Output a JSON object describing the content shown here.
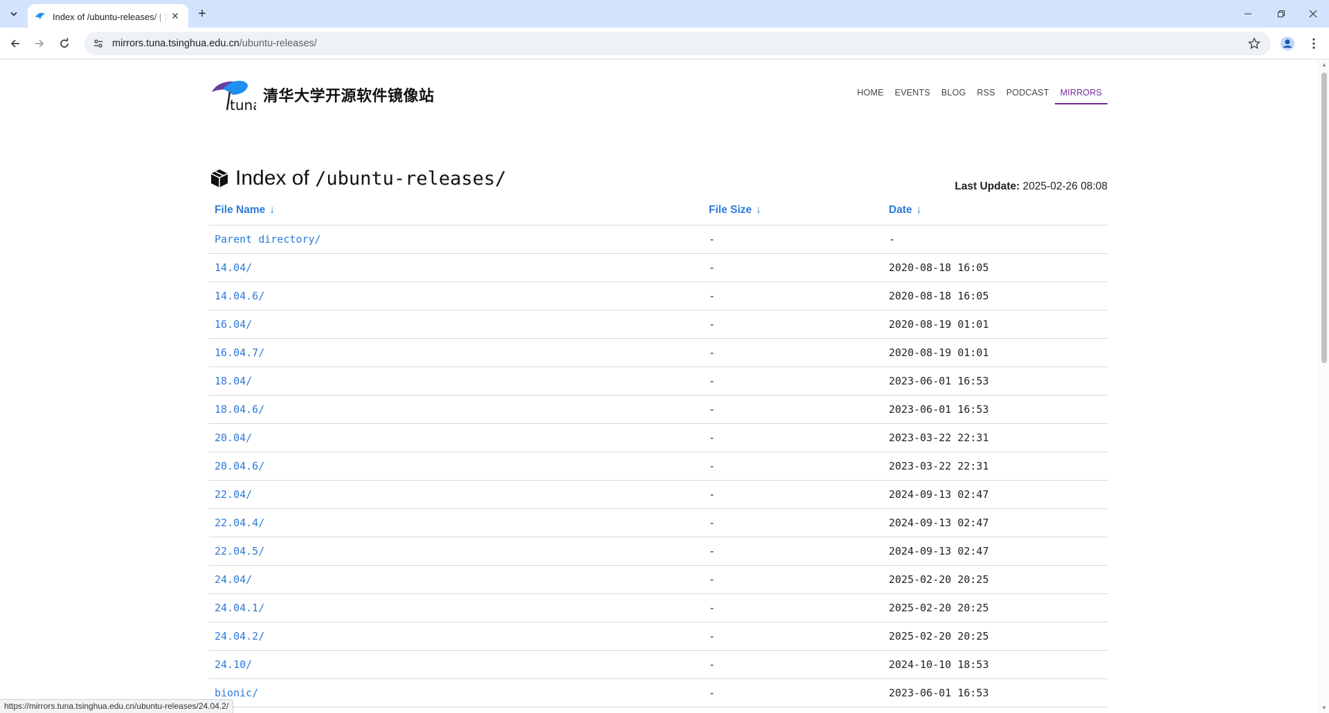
{
  "browser": {
    "tab_title": "Index of /ubuntu-releases/ | 清华大学开源软件镜像站",
    "url_host": "mirrors.tuna.tsinghua.edu.cn",
    "url_path": "/ubuntu-releases/",
    "status_url": "https://mirrors.tuna.tsinghua.edu.cn/ubuntu-releases/24.04.2/"
  },
  "site": {
    "logo_text": "清华大学开源软件镜像站",
    "nav": [
      "HOME",
      "EVENTS",
      "BLOG",
      "RSS",
      "PODCAST",
      "MIRRORS"
    ],
    "active_nav": "MIRRORS"
  },
  "index": {
    "title_prefix": "Index of",
    "title_path": "/ubuntu-releases/",
    "last_update_label": "Last Update:",
    "last_update_value": "2025-02-26 08:08",
    "columns": {
      "name": "File Name",
      "size": "File Size",
      "date": "Date",
      "sort_arrow": "↓"
    },
    "rows": [
      {
        "name": "Parent directory/",
        "size": "-",
        "date": "-"
      },
      {
        "name": "14.04/",
        "size": "-",
        "date": "2020-08-18 16:05"
      },
      {
        "name": "14.04.6/",
        "size": "-",
        "date": "2020-08-18 16:05"
      },
      {
        "name": "16.04/",
        "size": "-",
        "date": "2020-08-19 01:01"
      },
      {
        "name": "16.04.7/",
        "size": "-",
        "date": "2020-08-19 01:01"
      },
      {
        "name": "18.04/",
        "size": "-",
        "date": "2023-06-01 16:53"
      },
      {
        "name": "18.04.6/",
        "size": "-",
        "date": "2023-06-01 16:53"
      },
      {
        "name": "20.04/",
        "size": "-",
        "date": "2023-03-22 22:31"
      },
      {
        "name": "20.04.6/",
        "size": "-",
        "date": "2023-03-22 22:31"
      },
      {
        "name": "22.04/",
        "size": "-",
        "date": "2024-09-13 02:47"
      },
      {
        "name": "22.04.4/",
        "size": "-",
        "date": "2024-09-13 02:47"
      },
      {
        "name": "22.04.5/",
        "size": "-",
        "date": "2024-09-13 02:47"
      },
      {
        "name": "24.04/",
        "size": "-",
        "date": "2025-02-20 20:25"
      },
      {
        "name": "24.04.1/",
        "size": "-",
        "date": "2025-02-20 20:25"
      },
      {
        "name": "24.04.2/",
        "size": "-",
        "date": "2025-02-20 20:25"
      },
      {
        "name": "24.10/",
        "size": "-",
        "date": "2024-10-10 18:53"
      },
      {
        "name": "bionic/",
        "size": "-",
        "date": "2023-06-01 16:53"
      }
    ]
  }
}
